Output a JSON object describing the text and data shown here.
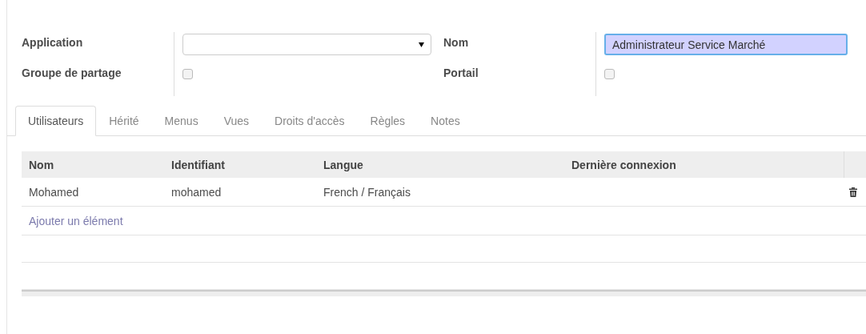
{
  "form": {
    "left": [
      {
        "label": "Application",
        "kind": "select"
      },
      {
        "label": "Groupe de partage",
        "kind": "checkbox",
        "checked": false
      }
    ],
    "right": [
      {
        "label": "Nom",
        "kind": "text",
        "value": "Administrateur Service Marché",
        "focused": true
      },
      {
        "label": "Portail",
        "kind": "checkbox",
        "checked": false
      }
    ]
  },
  "tabs": [
    {
      "label": "Utilisateurs",
      "selected": true
    },
    {
      "label": "Hérité",
      "selected": false
    },
    {
      "label": "Menus",
      "selected": false
    },
    {
      "label": "Vues",
      "selected": false
    },
    {
      "label": "Droits d'accès",
      "selected": false
    },
    {
      "label": "Règles",
      "selected": false
    },
    {
      "label": "Notes",
      "selected": false
    }
  ],
  "table": {
    "columns": [
      "Nom",
      "Identifiant",
      "Langue",
      "Dernière connexion"
    ],
    "rows": [
      [
        "Mohamed",
        "mohamed",
        "French / Français"
      ]
    ],
    "add_link": "Ajouter un élément"
  }
}
